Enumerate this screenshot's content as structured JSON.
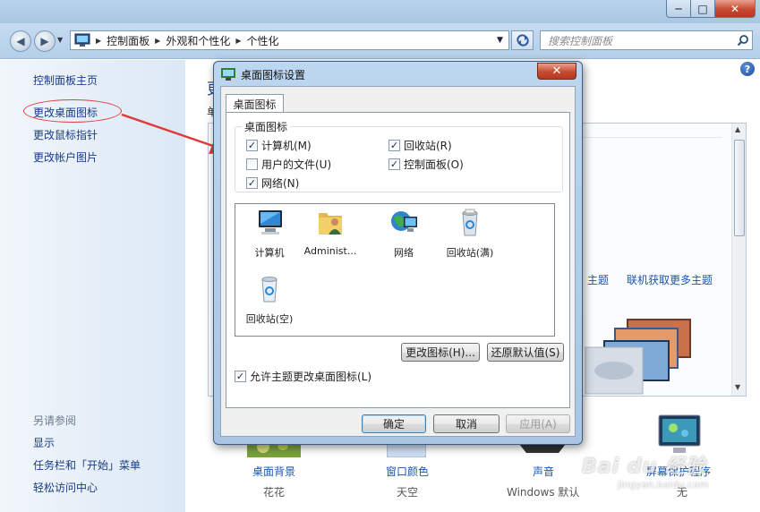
{
  "window": {
    "minimize": "─",
    "maximize": "□",
    "close": "✕"
  },
  "nav": {
    "back": "◀",
    "forward": "▶",
    "breadcrumbs": [
      "控制面板",
      "外观和个性化",
      "个性化"
    ],
    "search_placeholder": "搜索控制面板"
  },
  "sidebar": {
    "home": "控制面板主页",
    "items": [
      "更改桌面图标",
      "更改鼠标指针",
      "更改帐户图片"
    ],
    "see_also_title": "另请参阅",
    "see_also": [
      "显示",
      "任务栏和「开始」菜单",
      "轻松访问中心"
    ]
  },
  "main": {
    "heading_fragment": "更",
    "subheading_fragment": "单",
    "theme_links": [
      "主题",
      "联机获取更多主题"
    ],
    "bottom_items": [
      {
        "label": "桌面背景",
        "sub": "花花"
      },
      {
        "label": "窗口颜色",
        "sub": "天空"
      },
      {
        "label": "声音",
        "sub": "Windows 默认"
      },
      {
        "label": "屏幕保护程序",
        "sub": "无"
      }
    ]
  },
  "dialog": {
    "title": "桌面图标设置",
    "tab": "桌面图标",
    "group_label": "桌面图标",
    "checkboxes": [
      {
        "label": "计算机(M)",
        "checked": true
      },
      {
        "label": "回收站(R)",
        "checked": true
      },
      {
        "label": "用户的文件(U)",
        "checked": false
      },
      {
        "label": "控制面板(O)",
        "checked": true
      },
      {
        "label": "网络(N)",
        "checked": true
      }
    ],
    "icons": [
      {
        "label": "计算机",
        "icon": "computer-icon"
      },
      {
        "label": "Administ...",
        "icon": "user-folder-icon"
      },
      {
        "label": "网络",
        "icon": "network-icon"
      },
      {
        "label": "回收站(满)",
        "icon": "recycle-bin-full-icon"
      },
      {
        "label": "回收站(空)",
        "icon": "recycle-bin-empty-icon"
      }
    ],
    "change_icon_button": "更改图标(H)...",
    "restore_default_button": "还原默认值(S)",
    "allow_themes_label": "允许主题更改桌面图标(L)",
    "allow_themes_checked": true,
    "ok_button": "确定",
    "cancel_button": "取消",
    "apply_button": "应用(A)"
  },
  "watermark": {
    "brand": "Bai du 经验",
    "url": "jingyan.baidu.com"
  },
  "colors": {
    "link": "#1a3a8a",
    "annotation": "#e03a3a",
    "dialog_frame": "#a8c5e3"
  }
}
